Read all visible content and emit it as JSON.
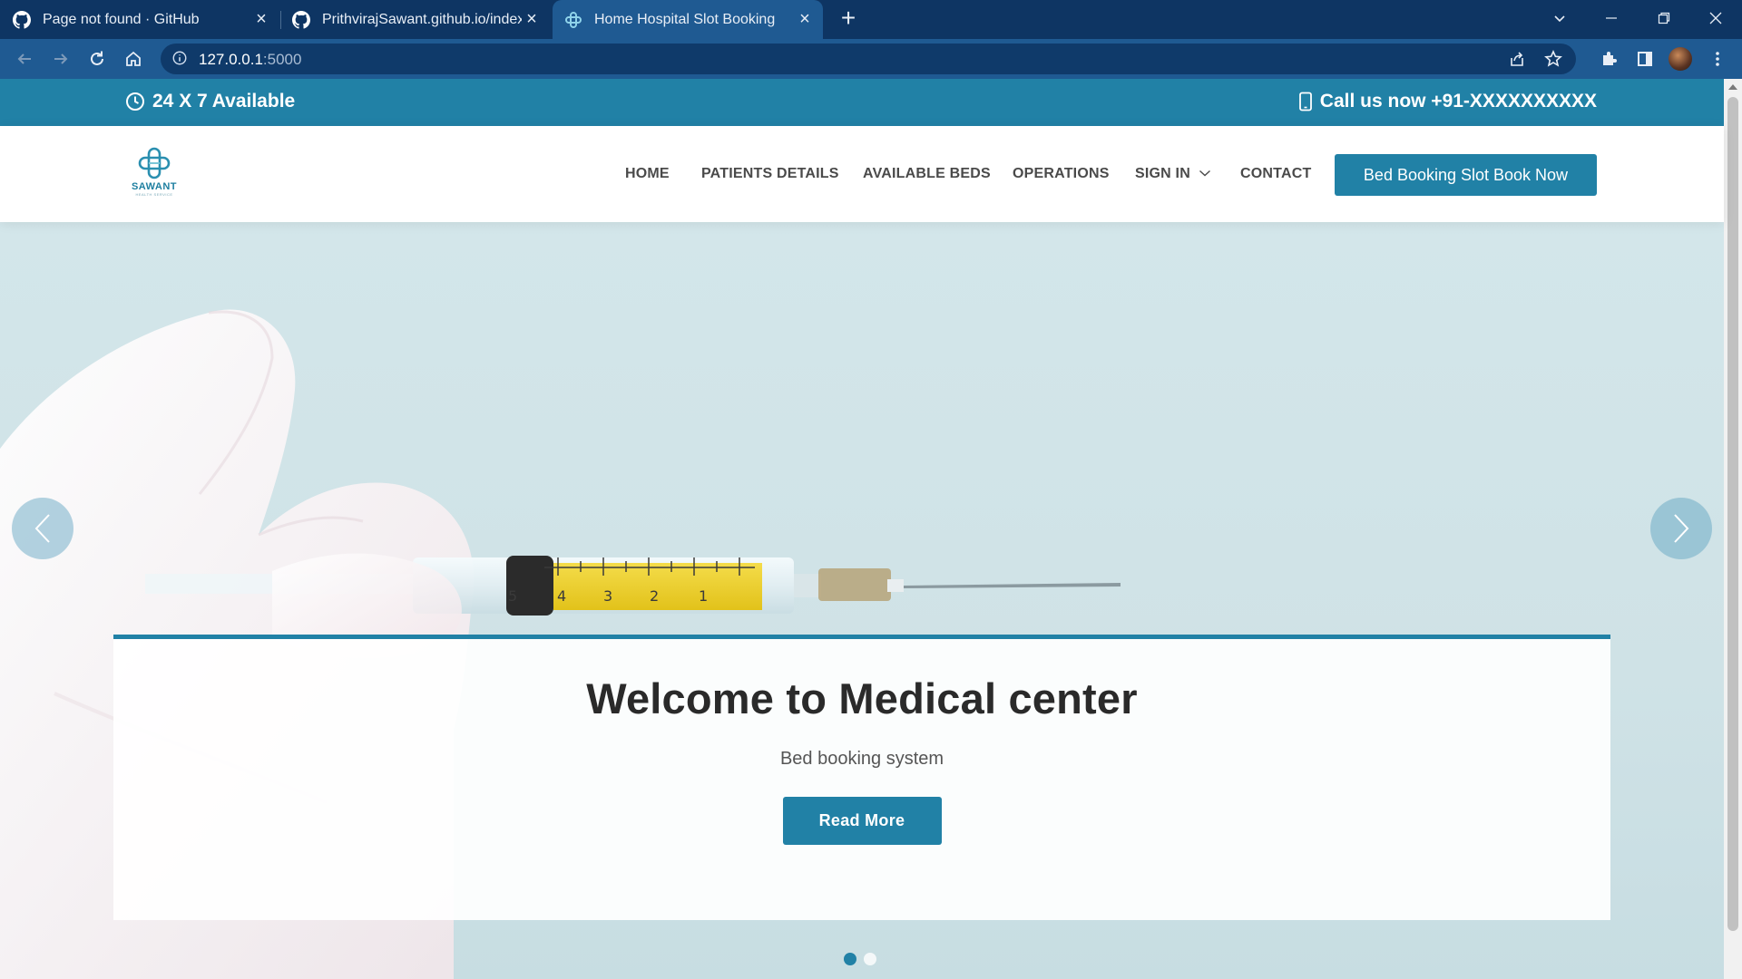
{
  "browser": {
    "tabs": [
      {
        "title": "Page not found · GitHub",
        "active": false
      },
      {
        "title": "PrithvirajSawant.github.io/index.h",
        "active": false
      },
      {
        "title": "Home Hospital Slot Booking",
        "active": true
      }
    ],
    "address": {
      "host": "127.0.0.1",
      "port": ":5000"
    }
  },
  "topbar": {
    "availability": "24 X 7 Available",
    "call": "Call us now +91-XXXXXXXXXX"
  },
  "logo": {
    "name": "SAWANT",
    "tagline": "HEALTH SERVICE"
  },
  "nav": {
    "items": [
      {
        "label": "HOME"
      },
      {
        "label": "PATIENTS DETAILS"
      },
      {
        "label": "AVAILABLE BEDS"
      },
      {
        "label": "OPERATIONS"
      },
      {
        "label": "SIGN IN"
      },
      {
        "label": "CONTACT"
      }
    ],
    "cta": "Bed Booking Slot Book Now"
  },
  "hero": {
    "title": "Welcome to Medical center",
    "subtitle": "Bed booking system",
    "button": "Read More",
    "slides_total": 2,
    "active_slide": 1,
    "syringe_marks": [
      "5",
      "4",
      "3",
      "2",
      "1"
    ]
  },
  "colors": {
    "brand": "#2181a6",
    "chrome_dark": "#0e3563",
    "chrome_toolbar": "#1f5a92"
  }
}
